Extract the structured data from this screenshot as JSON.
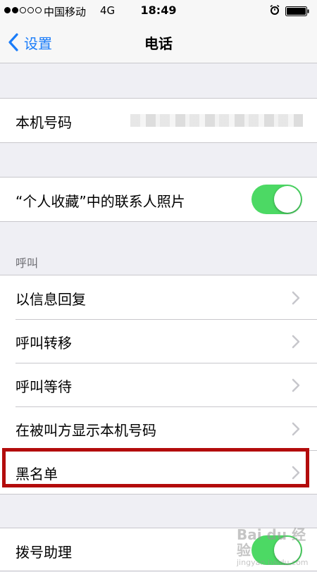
{
  "status_bar": {
    "carrier": "中国移动",
    "network": "4G",
    "time": "18:49"
  },
  "nav": {
    "back_label": "设置",
    "title": "电话"
  },
  "groups": {
    "my_number": {
      "label": "本机号码"
    },
    "favorites_photos": {
      "label": "“个人收藏”中的联系人照片",
      "enabled": true
    },
    "calls": {
      "header": "呼叫",
      "items": [
        {
          "label": "以信息回复"
        },
        {
          "label": "呼叫转移"
        },
        {
          "label": "呼叫等待"
        },
        {
          "label": "在被叫方显示本机号码"
        },
        {
          "label": "黑名单"
        }
      ]
    },
    "dial_assist": {
      "label": "拨号助理",
      "enabled": true
    }
  },
  "colors": {
    "accent": "#1a7cf9",
    "toggle_on": "#4cd964",
    "highlight": "#b30c0c"
  }
}
